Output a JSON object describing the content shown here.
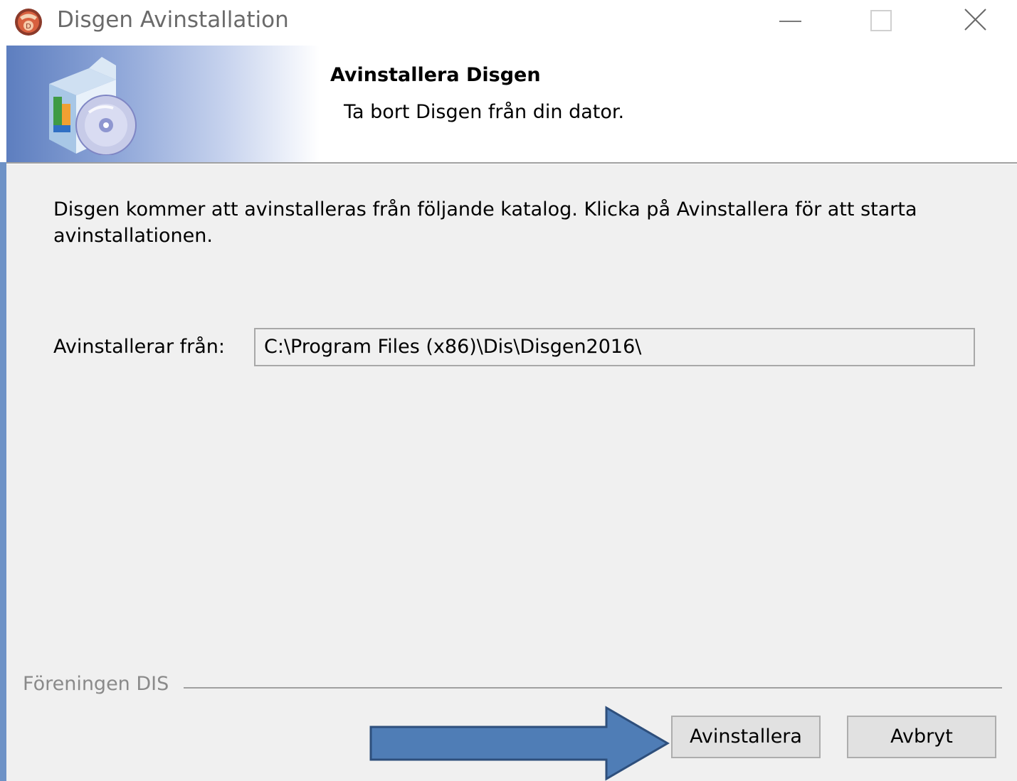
{
  "window": {
    "title": "Disgen Avinstallation"
  },
  "header": {
    "title": "Avinstallera Disgen",
    "subtitle": "Ta bort Disgen från din dator."
  },
  "main": {
    "description": "Disgen kommer att avinstalleras från följande katalog. Klicka på Avinstallera för att starta avinstallationen.",
    "path_label": "Avinstallerar från:",
    "path_value": "C:\\Program Files (x86)\\Dis\\Disgen2016\\"
  },
  "footer": {
    "brand": "Föreningen DIS",
    "uninstall_label": "Avinstallera",
    "cancel_label": "Avbryt"
  },
  "colors": {
    "annotation_arrow": "#4f7db6",
    "header_gradient": "#5d7ebf"
  },
  "icons": {
    "app": "disgen-app-icon",
    "header": "software-box-cd-icon",
    "annotation": "right-arrow-annotation"
  }
}
